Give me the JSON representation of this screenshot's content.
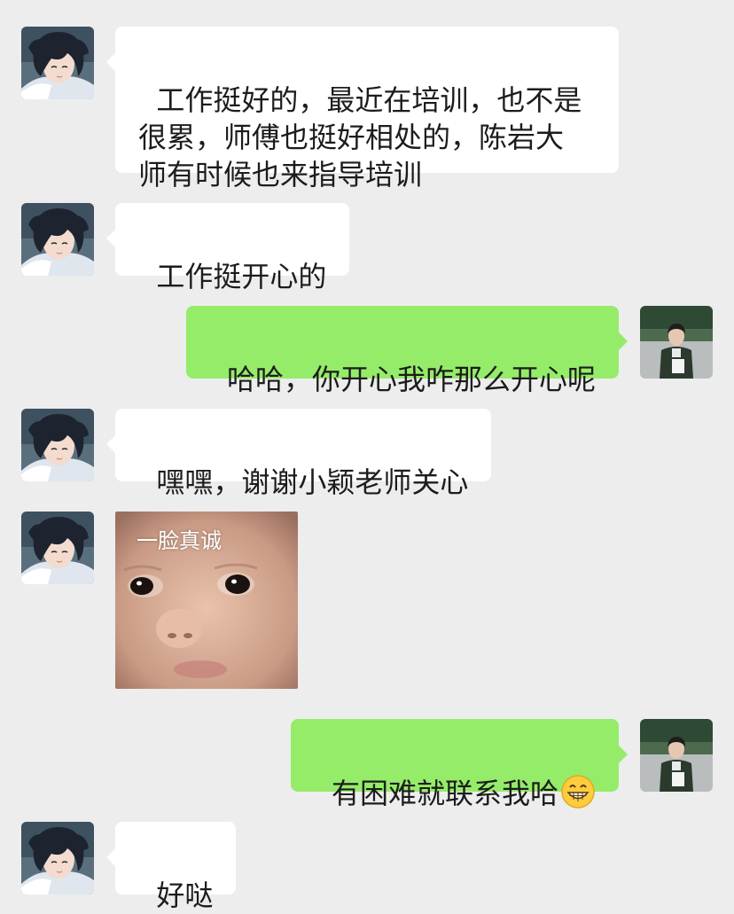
{
  "messages": [
    {
      "sender": "other",
      "text": "工作挺好的，最近在培训，也不是\n很累，师傅也挺好相处的，陈岩大\n师有时候也来指导培训"
    },
    {
      "sender": "other",
      "text": "工作挺开心的"
    },
    {
      "sender": "me",
      "text": "哈哈，你开心我咋那么开心呢"
    },
    {
      "sender": "other",
      "text": "嘿嘿，谢谢小颖老师关心"
    },
    {
      "sender": "other",
      "type": "sticker",
      "caption": "一脸真诚"
    },
    {
      "sender": "me",
      "text": "有困难就联系我哈",
      "emoji": "grinning-face-emoji"
    },
    {
      "sender": "other",
      "text": "好哒"
    }
  ],
  "colors": {
    "background": "#ededed",
    "incoming_bubble": "#ffffff",
    "outgoing_bubble": "#95ec69"
  },
  "icons": {
    "other_avatar": "anime-character-avatar",
    "my_avatar": "uniformed-person-avatar"
  }
}
